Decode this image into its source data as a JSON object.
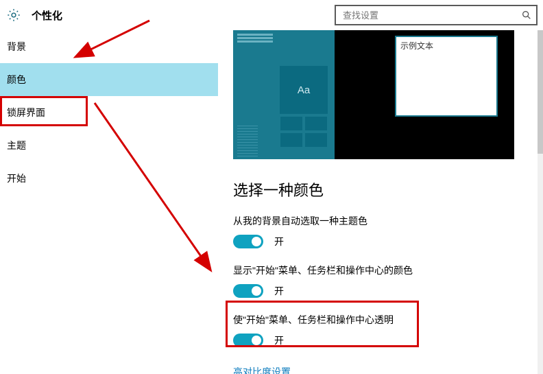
{
  "header": {
    "title": "个性化",
    "search_placeholder": "查找设置"
  },
  "sidebar": {
    "items": [
      {
        "label": "背景"
      },
      {
        "label": "颜色"
      },
      {
        "label": "锁屏界面"
      },
      {
        "label": "主题"
      },
      {
        "label": "开始"
      }
    ],
    "active_index": 1
  },
  "preview": {
    "sample_text": "示例文本",
    "tile_glyph": "Aa"
  },
  "content": {
    "section_title": "选择一种颜色",
    "options": [
      {
        "label": "从我的背景自动选取一种主题色",
        "state": "开",
        "on": true
      },
      {
        "label": "显示\"开始\"菜单、任务栏和操作中心的颜色",
        "state": "开",
        "on": true
      },
      {
        "label": "使\"开始\"菜单、任务栏和操作中心透明",
        "state": "开",
        "on": true
      }
    ],
    "link": "高对比度设置"
  },
  "colors": {
    "accent": "#0fa2c0",
    "sidebar_active_bg": "#a1dfee",
    "annotation_red": "#d40000",
    "link": "#0b7bbd"
  },
  "icons": {
    "gear": "gear-icon",
    "search": "search-icon"
  }
}
